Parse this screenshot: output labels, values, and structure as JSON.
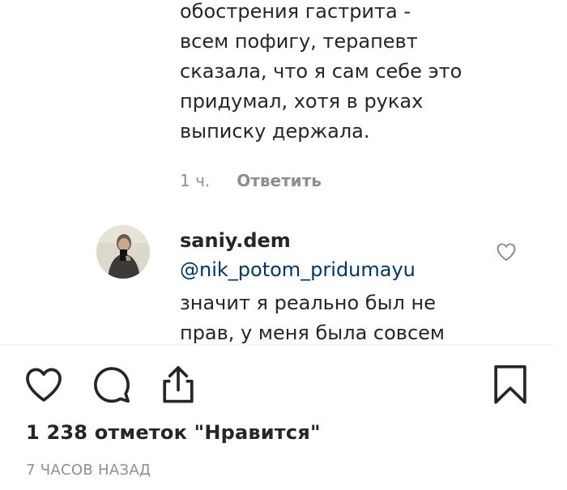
{
  "previous_comment": {
    "text": "обострения гастрита -\nвсем пофигу, терапевт\nсказала, что я сам себе это\nпридумал, хотя в руках\nвыписку держала.",
    "time": "1 ч.",
    "reply_label": "Ответить"
  },
  "comment": {
    "author": "saniy.dem",
    "mention": "@nik_potom_pridumayu",
    "text": "значит я реально был не\nправ, у меня была совсем",
    "avatar_icon": "user-avatar",
    "like_icon": "heart-outline-icon"
  },
  "actions": {
    "like_icon": "heart-icon",
    "comment_icon": "comment-bubble-icon",
    "share_icon": "share-upload-icon",
    "save_icon": "bookmark-icon"
  },
  "likes_text": "1 238 отметок \"Нравится\"",
  "posted_time": "7 ЧАСОВ НАЗАД",
  "colors": {
    "text": "#262626",
    "muted": "#8e8e8e",
    "link": "#003569",
    "divider": "#efefef"
  }
}
